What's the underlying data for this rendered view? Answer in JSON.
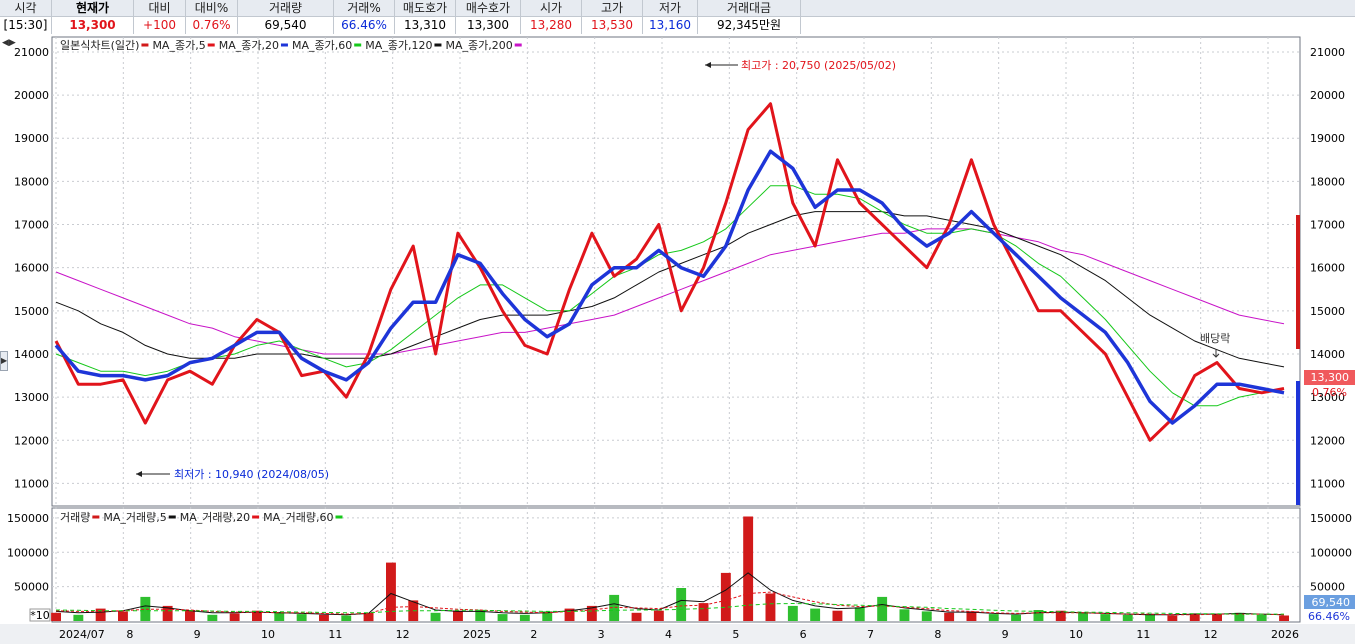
{
  "quote": {
    "headers": [
      "시각",
      "현재가",
      "대비",
      "대비%",
      "거래량",
      "거래%",
      "매도호가",
      "매수호가",
      "시가",
      "고가",
      "저가",
      "거래대금"
    ],
    "values": [
      "[15:30]",
      "13,300",
      "+100",
      "0.76%",
      "69,540",
      "66.46%",
      "13,310",
      "13,300",
      "13,280",
      "13,530",
      "13,160",
      "92,345만원"
    ]
  },
  "legend_price": [
    {
      "label": "일본식차트(일간)",
      "color": "#d11a1a"
    },
    {
      "label": "MA_종가,5",
      "color": "#e1141b"
    },
    {
      "label": "MA_종가,20",
      "color": "#1e35d8"
    },
    {
      "label": "MA_종가,60",
      "color": "#16c81a"
    },
    {
      "label": "MA_종가,120",
      "color": "#111111"
    },
    {
      "label": "MA_종가,200",
      "color": "#c814c8"
    }
  ],
  "legend_volume": [
    {
      "label": "거래량",
      "color": "#d11a1a"
    },
    {
      "label": "MA_거래량,5",
      "color": "#111111"
    },
    {
      "label": "MA_거래량,20",
      "color": "#e1141b"
    },
    {
      "label": "MA_거래량,60",
      "color": "#16c81a"
    }
  ],
  "annotations": {
    "high": "최고가 : 20,750 (2025/05/02)",
    "low": "최저가 : 10,940 (2024/08/05)",
    "dividend": "배당락"
  },
  "current_price_tag": "13,300",
  "current_change_tag": "0.76%",
  "current_volume_tag": "69,540",
  "current_volume_pct_tag": "66.46%",
  "volume_scale_tag": "*10",
  "nav_icon": "◀▶",
  "side_icon": "▶",
  "colors": {
    "up": "#e1141b",
    "down": "#0a2bd8",
    "ma5": "#e1141b",
    "ma20": "#1e35d8",
    "ma60": "#16c81a",
    "ma120": "#111111",
    "ma200": "#c814c8",
    "grid": "#c9ccd1"
  },
  "chart_data": [
    {
      "type": "line",
      "title": "",
      "ylim": [
        10500,
        21300
      ],
      "y_ticks": [
        11000,
        12000,
        13000,
        14000,
        15000,
        16000,
        17000,
        18000,
        19000,
        20000,
        21000
      ],
      "x_ticks": [
        "2024/07",
        "8",
        "9",
        "10",
        "11",
        "12",
        "2025",
        "2",
        "3",
        "4",
        "5",
        "6",
        "7",
        "8",
        "9",
        "10",
        "11",
        "12",
        "2026"
      ],
      "series": [
        {
          "name": "MA_종가,5",
          "values": [
            14300,
            13300,
            13300,
            13400,
            12400,
            13400,
            13600,
            13300,
            14200,
            14800,
            14500,
            13500,
            13600,
            13000,
            14000,
            15500,
            16500,
            14000,
            16800,
            16000,
            15000,
            14200,
            14000,
            15500,
            16800,
            15800,
            16200,
            17000,
            15000,
            16000,
            17500,
            19200,
            19800,
            17500,
            16500,
            18500,
            17500,
            17000,
            16500,
            16000,
            17000,
            18500,
            17000,
            16000,
            15000,
            15000,
            14500,
            14000,
            13000,
            12000,
            12500,
            13500,
            13800,
            13200,
            13100,
            13200
          ]
        },
        {
          "name": "MA_종가,20",
          "values": [
            14200,
            13600,
            13500,
            13500,
            13400,
            13500,
            13800,
            13900,
            14200,
            14500,
            14500,
            13900,
            13600,
            13400,
            13800,
            14600,
            15200,
            15200,
            16300,
            16100,
            15400,
            14800,
            14400,
            14700,
            15600,
            16000,
            16000,
            16400,
            16000,
            15800,
            16500,
            17800,
            18700,
            18300,
            17400,
            17800,
            17800,
            17500,
            16900,
            16500,
            16800,
            17300,
            16800,
            16300,
            15800,
            15300,
            14900,
            14500,
            13800,
            12900,
            12400,
            12800,
            13300,
            13300,
            13200,
            13100
          ]
        },
        {
          "name": "MA_종가,60",
          "values": [
            14000,
            13800,
            13600,
            13600,
            13500,
            13600,
            13800,
            13900,
            14000,
            14200,
            14300,
            14100,
            13900,
            13700,
            13800,
            14100,
            14500,
            14900,
            15300,
            15600,
            15600,
            15300,
            15000,
            15000,
            15400,
            15800,
            16000,
            16300,
            16400,
            16600,
            16900,
            17400,
            17900,
            17900,
            17700,
            17700,
            17600,
            17300,
            17000,
            16800,
            16800,
            16900,
            16800,
            16500,
            16100,
            15800,
            15300,
            14800,
            14200,
            13600,
            13100,
            12800,
            12800,
            13000,
            13100,
            13200
          ]
        },
        {
          "name": "MA_종가,120",
          "values": [
            15200,
            15000,
            14700,
            14500,
            14200,
            14000,
            13900,
            13900,
            13900,
            14000,
            14000,
            14000,
            13900,
            13900,
            13900,
            14000,
            14200,
            14400,
            14600,
            14800,
            14900,
            14900,
            14900,
            15000,
            15100,
            15300,
            15600,
            15900,
            16100,
            16300,
            16500,
            16800,
            17000,
            17200,
            17300,
            17300,
            17300,
            17300,
            17200,
            17200,
            17100,
            17000,
            16900,
            16700,
            16500,
            16300,
            16000,
            15700,
            15300,
            14900,
            14600,
            14300,
            14100,
            13900,
            13800,
            13700
          ]
        },
        {
          "name": "MA_종가,200",
          "values": [
            15900,
            15700,
            15500,
            15300,
            15100,
            14900,
            14700,
            14600,
            14400,
            14300,
            14200,
            14100,
            14000,
            14000,
            14000,
            14000,
            14100,
            14200,
            14300,
            14400,
            14500,
            14500,
            14600,
            14700,
            14800,
            14900,
            15100,
            15300,
            15500,
            15700,
            15900,
            16100,
            16300,
            16400,
            16500,
            16600,
            16700,
            16800,
            16800,
            16900,
            16900,
            16900,
            16800,
            16700,
            16600,
            16400,
            16300,
            16100,
            15900,
            15700,
            15500,
            15300,
            15100,
            14900,
            14800,
            14700
          ]
        }
      ]
    },
    {
      "type": "bar",
      "title": "",
      "ylim": [
        0,
        160000
      ],
      "y_ticks": [
        50000,
        100000,
        150000
      ],
      "series": [
        {
          "name": "거래량",
          "values": [
            12000,
            9000,
            18000,
            14000,
            35000,
            22000,
            16000,
            9000,
            11000,
            15000,
            13000,
            10000,
            9000,
            8000,
            12000,
            85000,
            30000,
            12000,
            15000,
            16000,
            10000,
            9000,
            14000,
            18000,
            22000,
            38000,
            12000,
            15000,
            48000,
            26000,
            70000,
            152000,
            40000,
            22000,
            18000,
            15000,
            20000,
            35000,
            17000,
            14000,
            12000,
            14000,
            10000,
            9000,
            16000,
            15000,
            12000,
            10000,
            9000,
            10000,
            8000,
            11000,
            10000,
            12000,
            9000,
            8000
          ]
        },
        {
          "name": "MA_거래량,5",
          "values": [
            14000,
            12000,
            13000,
            15000,
            22000,
            19000,
            15000,
            12000,
            12000,
            13000,
            12000,
            11000,
            10000,
            9000,
            11000,
            40000,
            28000,
            16000,
            14000,
            14000,
            12000,
            11000,
            12000,
            15000,
            19000,
            25000,
            18000,
            16000,
            30000,
            28000,
            45000,
            70000,
            45000,
            30000,
            22000,
            18000,
            19000,
            24000,
            19000,
            16000,
            13000,
            13000,
            11000,
            10000,
            12000,
            13000,
            12000,
            11000,
            10000,
            9000,
            9000,
            10000,
            10000,
            11000,
            10000,
            9000
          ]
        },
        {
          "name": "MA_거래량,20",
          "values": [
            15000,
            14000,
            14000,
            15000,
            17000,
            17000,
            16000,
            14000,
            13000,
            13000,
            12000,
            12000,
            11000,
            10000,
            11000,
            20000,
            21000,
            19000,
            17000,
            16000,
            14000,
            13000,
            12000,
            14000,
            16000,
            20000,
            19000,
            18000,
            22000,
            23000,
            30000,
            40000,
            42000,
            35000,
            28000,
            23000,
            21000,
            22000,
            20000,
            18000,
            15000,
            14000,
            12000,
            11000,
            12000,
            12000,
            12000,
            11000,
            10000,
            10000,
            9000,
            9000,
            10000,
            10000,
            10000,
            9000
          ]
        },
        {
          "name": "MA_거래량,60",
          "values": [
            16000,
            15500,
            15000,
            15000,
            15000,
            15000,
            15000,
            14500,
            14000,
            14000,
            13500,
            13000,
            12500,
            12000,
            12000,
            14000,
            15000,
            15000,
            15500,
            15500,
            15000,
            14500,
            14000,
            14000,
            14500,
            15500,
            16000,
            16000,
            17000,
            18000,
            20000,
            23000,
            25000,
            25500,
            25000,
            24000,
            23000,
            22000,
            21000,
            20000,
            18000,
            17000,
            15500,
            14500,
            14000,
            13500,
            13000,
            12500,
            12000,
            11500,
            11000,
            10500,
            10500,
            10000,
            10000,
            10000
          ]
        }
      ]
    }
  ]
}
